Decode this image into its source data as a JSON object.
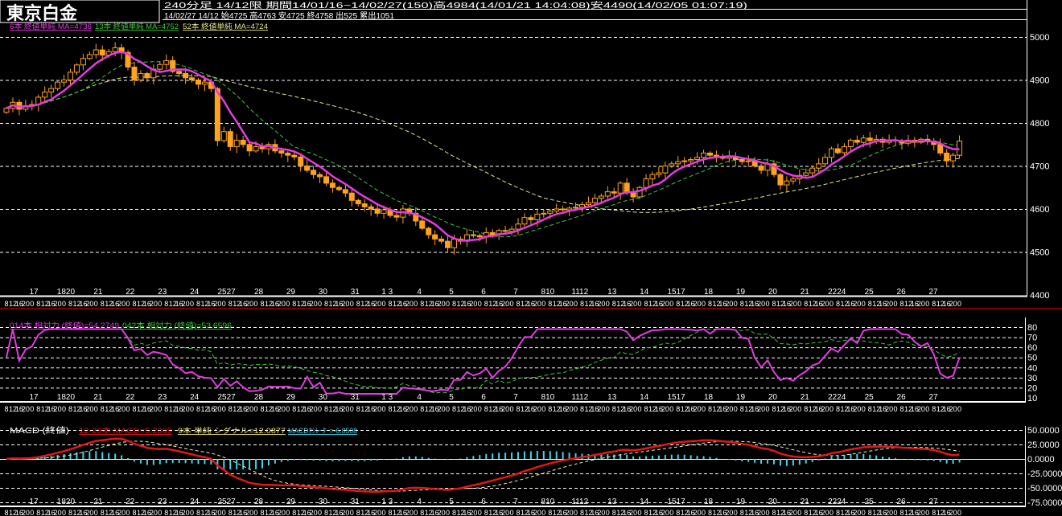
{
  "header": {
    "title": "東京白金",
    "info_line1": "240分足 14/12限  期間14/01/16~14/02/27(150)高4984(14/01/21 14:04:08)安4490(14/02/05 01:07:19)",
    "info_line2": "14/02/27 14/12 始4725 高4763 安4725 終4758 出525 累出1051"
  },
  "legend_main": {
    "ma6": "6本 終値単純 MA=4736",
    "ma13": "13本 終値単純 MA=4752",
    "ma52": "52本 終値単純 MA=4724"
  },
  "legend_rsi": {
    "rsi14": "014本 相対力 (終値)=54.2749",
    "rsi42": "042本 相対力 (終値)=53.6596"
  },
  "legend_macd": {
    "title": "MACD (終値)",
    "macd": "12-26本 MACD=5.2369",
    "signal": "9本 単純 シグナル=12.0877",
    "osc": "MACDｵｼﾚｰﾀｰ=-6.8508"
  },
  "colors": {
    "candle": "#ffa31f",
    "ma6": "#e23ce2",
    "ma13": "#3cc83c",
    "ma52": "#e6e68a",
    "macd": "#e01818",
    "signal": "#f0f0c0",
    "hist": "#46d2e6",
    "separator": "#c00000"
  },
  "chart_data": {
    "type": "candlestick",
    "title": "東京白金 240分足 14/12限",
    "price_axis": {
      "ticks": [
        "5000",
        "4900",
        "4800",
        "4700",
        "4600",
        "4500",
        "4400"
      ],
      "ylim": [
        4400,
        5000
      ]
    },
    "rsi_axis": {
      "ticks": [
        "80",
        "70",
        "60",
        "50",
        "40",
        "30",
        "20",
        "10"
      ],
      "ylim": [
        10,
        80
      ]
    },
    "macd_axis": {
      "ticks": [
        "50.0000",
        "25.0000",
        "0.0000",
        "-25.0000",
        "-50.0000",
        "-75.0000"
      ],
      "ylim": [
        -75,
        50
      ]
    },
    "day_labels": [
      "17",
      "1820",
      "21",
      "22",
      "23",
      "24",
      "2527",
      "28",
      "29",
      "30",
      "31",
      "1 3",
      "4",
      "5",
      "6",
      "7",
      "810",
      "1112",
      "13",
      "14",
      "1517",
      "18",
      "19",
      "20",
      "21",
      "2224",
      "25",
      "26",
      "27"
    ],
    "time_labels": [
      "8",
      "12",
      "16",
      "20",
      "0"
    ],
    "first_open": 4825,
    "close": [
      4834,
      4848,
      4832,
      4840,
      4843,
      4860,
      4872,
      4880,
      4895,
      4900,
      4918,
      4935,
      4950,
      4959,
      4970,
      4958,
      4966,
      4975,
      4964,
      4930,
      4900,
      4915,
      4905,
      4925,
      4936,
      4945,
      4920,
      4915,
      4905,
      4900,
      4890,
      4895,
      4880,
      4759,
      4780,
      4745,
      4760,
      4750,
      4735,
      4745,
      4740,
      4750,
      4735,
      4730,
      4725,
      4721,
      4700,
      4690,
      4680,
      4675,
      4660,
      4650,
      4645,
      4637,
      4620,
      4612,
      4605,
      4600,
      4590,
      4598,
      4585,
      4581,
      4600,
      4590,
      4572,
      4555,
      4540,
      4530,
      4525,
      4510,
      4530,
      4525,
      4540,
      4538,
      4535,
      4545,
      4540,
      4550,
      4548,
      4553,
      4565,
      4580,
      4575,
      4588,
      4590,
      4595,
      4600,
      4598,
      4602,
      4604,
      4610,
      4615,
      4625,
      4630,
      4640,
      4637,
      4660,
      4640,
      4628,
      4650,
      4670,
      4680,
      4684,
      4700,
      4705,
      4710,
      4712,
      4715,
      4720,
      4730,
      4725,
      4721,
      4718,
      4722,
      4715,
      4710,
      4712,
      4700,
      4690,
      4705,
      4680,
      4656,
      4665,
      4670,
      4678,
      4684,
      4695,
      4705,
      4720,
      4740,
      4731,
      4745,
      4760,
      4755,
      4765,
      4759,
      4762,
      4755,
      4760,
      4758,
      4753,
      4760,
      4755,
      4762,
      4758,
      4750,
      4730,
      4712,
      4725,
      4758
    ],
    "series": [
      {
        "name": "6本 MA",
        "period": 6
      },
      {
        "name": "13本 MA",
        "period": 13
      },
      {
        "name": "52本 MA",
        "period": 52
      },
      {
        "name": "RSI 14",
        "period": 14
      },
      {
        "name": "RSI 42",
        "period": 42
      },
      {
        "name": "MACD 12-26 / signal 9"
      }
    ]
  }
}
